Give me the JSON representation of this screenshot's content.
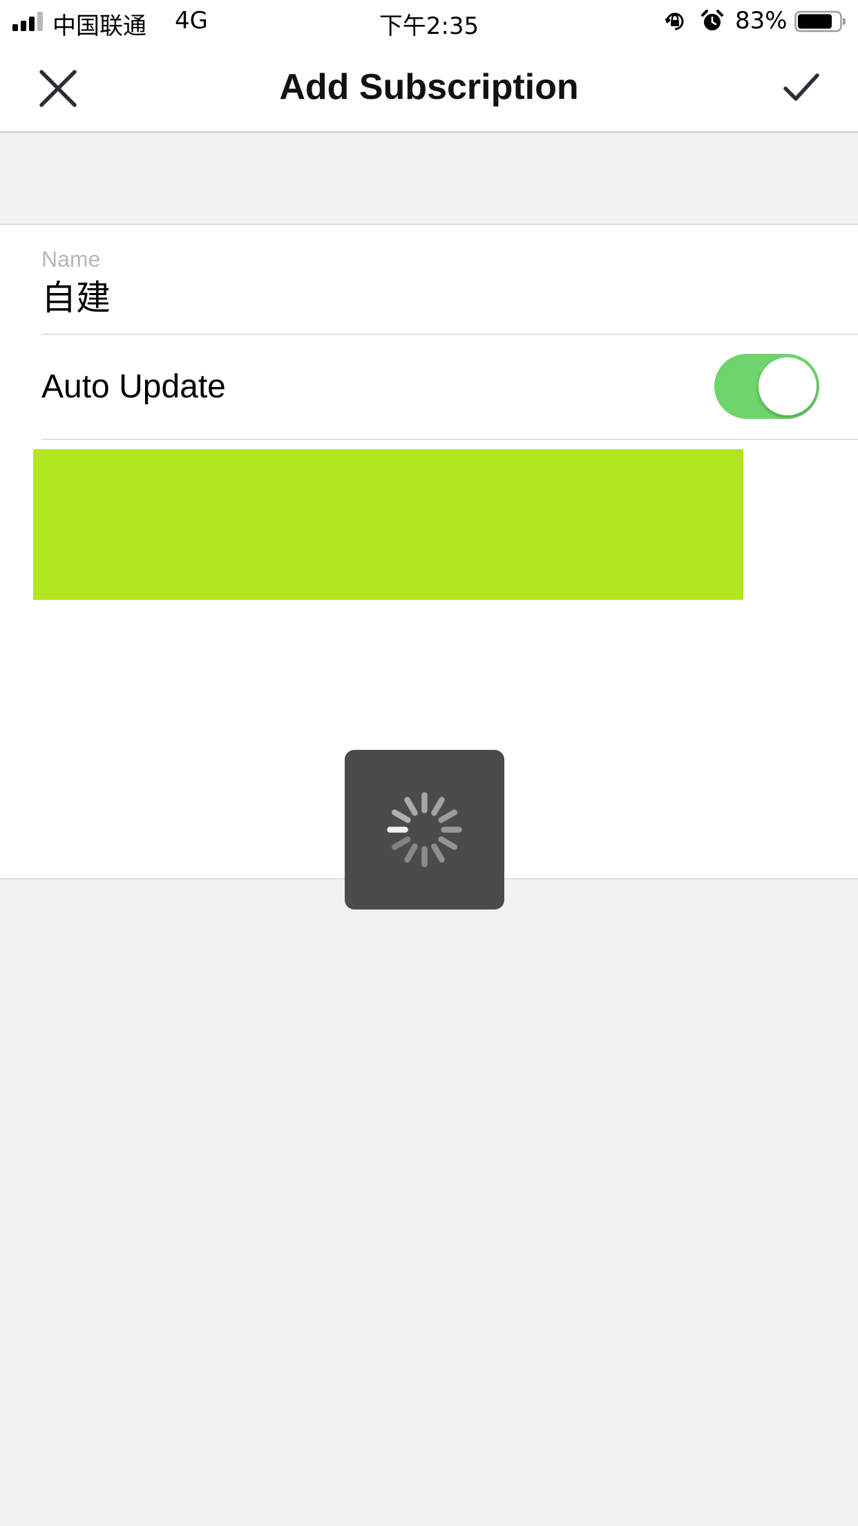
{
  "status_bar": {
    "carrier": "中国联通",
    "network": "4G",
    "time": "下午2:35",
    "battery_percent": "83%",
    "icons": [
      "signal-icon",
      "orientation-lock-icon",
      "alarm-icon",
      "battery-icon"
    ],
    "battery_level": 0.83
  },
  "nav": {
    "title": "Add Subscription",
    "close_icon": "close-icon",
    "done_icon": "checkmark-icon"
  },
  "form": {
    "name_label": "Name",
    "name_value": "自建",
    "auto_update_label": "Auto Update",
    "auto_update_on": true
  },
  "loading": {
    "icon": "spinner-icon"
  },
  "colors": {
    "toggle_on": "#6ed46c",
    "redaction": "#b3e61e",
    "hud": "#4b4b4b",
    "background": "#f1f2f4"
  }
}
